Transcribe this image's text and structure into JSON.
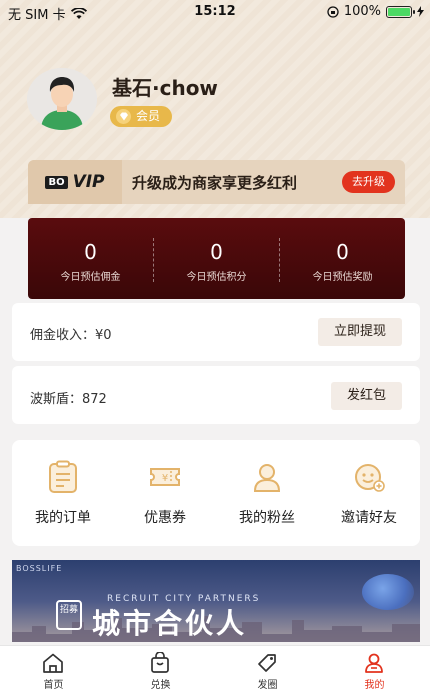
{
  "status_bar": {
    "carrier": "无 SIM 卡",
    "time": "15:12",
    "battery": "100%"
  },
  "profile": {
    "username": "基石·chow",
    "badge": "会员"
  },
  "vip": {
    "logo": "BO",
    "tag": "VIP",
    "description": "升级成为商家享更多红利",
    "button": "去升级"
  },
  "earnings": [
    {
      "value": "0",
      "label": "今日预估佣金"
    },
    {
      "value": "0",
      "label": "今日预估积分"
    },
    {
      "value": "0",
      "label": "今日预估奖励"
    }
  ],
  "commission": {
    "label": "佣金收入：",
    "value": "¥0",
    "button": "立即提现"
  },
  "bosidun": {
    "label": "波斯盾：",
    "value": "872",
    "button": "发红包"
  },
  "shortcuts": [
    {
      "label": "我的订单",
      "icon": "order-icon"
    },
    {
      "label": "优惠券",
      "icon": "coupon-icon"
    },
    {
      "label": "我的粉丝",
      "icon": "fans-icon"
    },
    {
      "label": "邀请好友",
      "icon": "invite-icon"
    }
  ],
  "promo": {
    "brand": "BOSSLIFE",
    "badge": "招募",
    "english": "RECRUIT CITY PARTNERS",
    "title": "城市合伙人"
  },
  "tabs": [
    {
      "label": "首页",
      "icon": "home-icon",
      "active": false
    },
    {
      "label": "兑换",
      "icon": "exchange-bag-icon",
      "active": false
    },
    {
      "label": "发圈",
      "icon": "tag-icon",
      "active": false
    },
    {
      "label": "我的",
      "icon": "profile-icon",
      "active": true
    }
  ],
  "colors": {
    "accent": "#e2331e",
    "gold": "#e8b84a",
    "dark_red": "#4a090b",
    "icon_gold": "#e3b36a"
  }
}
